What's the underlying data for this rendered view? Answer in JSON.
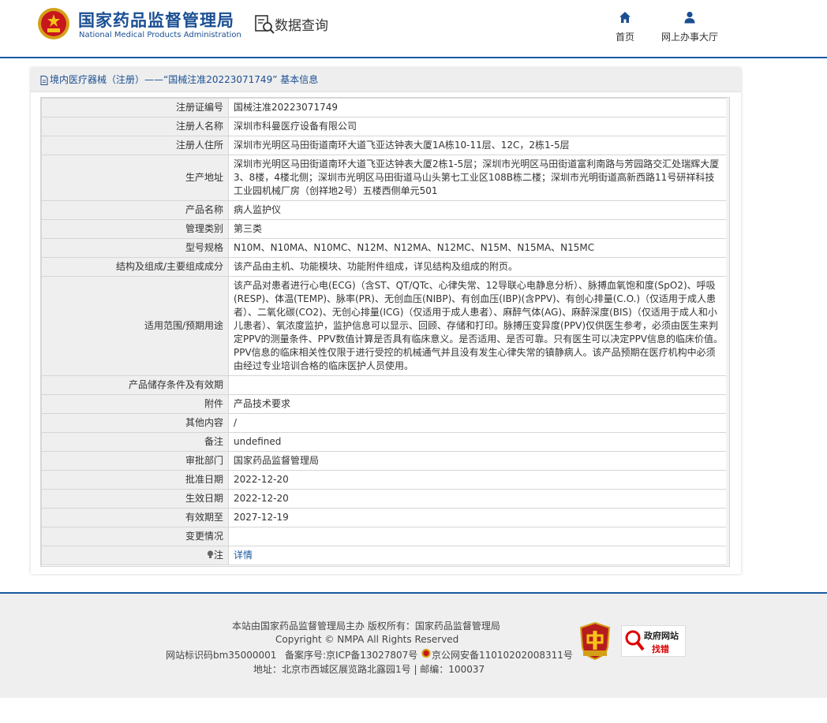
{
  "header": {
    "brand_cn": "国家药品监督管理局",
    "brand_en": "National Medical Products Administration",
    "search_title": "数据查询",
    "nav": {
      "home": "首页",
      "hall": "网上办事大厅"
    },
    "brand_color": "#1b4f93"
  },
  "card": {
    "breadcrumb": "境内医疗器械（注册）——“国械注准20223071749” 基本信息",
    "rows": [
      {
        "label": "注册证编号",
        "value": "国械注准20223071749"
      },
      {
        "label": "注册人名称",
        "value": "深圳市科曼医疗设备有限公司"
      },
      {
        "label": "注册人住所",
        "value": "深圳市光明区马田街道南环大道飞亚达钟表大厦1A栋10-11层、12C，2栋1-5层"
      },
      {
        "label": "生产地址",
        "value": "深圳市光明区马田街道南环大道飞亚达钟表大厦2栋1-5层；深圳市光明区马田街道富利南路与芳园路交汇处瑞辉大厦3、8楼，4楼北侧；深圳市光明区马田街道马山头第七工业区108B栋二楼；深圳市光明街道高新西路11号研祥科技工业园机械厂房（创祥地2号）五楼西侧单元501"
      },
      {
        "label": "产品名称",
        "value": "病人监护仪"
      },
      {
        "label": "管理类别",
        "value": "第三类"
      },
      {
        "label": "型号规格",
        "value": "N10M、N10MA、N10MC、N12M、N12MA、N12MC、N15M、N15MA、N15MC"
      },
      {
        "label": "结构及组成/主要组成成分",
        "value": "该产品由主机、功能模块、功能附件组成，详见结构及组成的附页。"
      },
      {
        "label": "适用范围/预期用途",
        "value": "该产品对患者进行心电(ECG)（含ST、QT/QTc、心律失常、12导联心电静息分析）、脉搏血氧饱和度(SpO2)、呼吸(RESP)、体温(TEMP)、脉率(PR)、无创血压(NIBP)、有创血压(IBP)(含PPV)、有创心排量(C.O.)（仅适用于成人患者）、二氧化碳(CO2)、无创心排量(ICG)（仅适用于成人患者）、麻醉气体(AG)、麻醉深度(BIS)（仅适用于成人和小儿患者）、氧浓度监护，监护信息可以显示、回顾、存储和打印。脉搏压变异度(PPV)仅供医生参考，必须由医生来判定PPV的测量条件、PPV数值计算是否具有临床意义。是否适用、是否可靠。只有医生可以决定PPV信息的临床价值。PPV信息的临床相关性仅限于进行受控的机械通气并且没有发生心律失常的镇静病人。该产品预期在医疗机构中必须由经过专业培训合格的临床医护人员使用。"
      },
      {
        "label": "产品储存条件及有效期",
        "value": ""
      },
      {
        "label": "附件",
        "value": "产品技术要求"
      },
      {
        "label": "其他内容",
        "value": "/"
      },
      {
        "label": "备注",
        "value": "undefined"
      },
      {
        "label": "审批部门",
        "value": "国家药品监督管理局"
      },
      {
        "label": "批准日期",
        "value": "2022-12-20"
      },
      {
        "label": "生效日期",
        "value": "2022-12-20"
      },
      {
        "label": "有效期至",
        "value": "2027-12-19"
      },
      {
        "label": "变更情况",
        "value": ""
      }
    ],
    "note_label": "注",
    "note_link": "详情"
  },
  "footer": {
    "line1": "本站由国家药品监督管理局主办 版权所有：国家药品监督管理局",
    "line2": "Copyright © NMPA All Rights Reserved",
    "site_id": "网站标识码bm35000001",
    "icp": "备案序号:京ICP备13027807号",
    "police": "京公网安备11010202008311号",
    "address": "地址：北京市西城区展览路北露园1号 | 邮编：100037",
    "badge_red_text": "党政机关",
    "gov_badge_line1": "政府网站",
    "gov_badge_line2": "找错"
  }
}
